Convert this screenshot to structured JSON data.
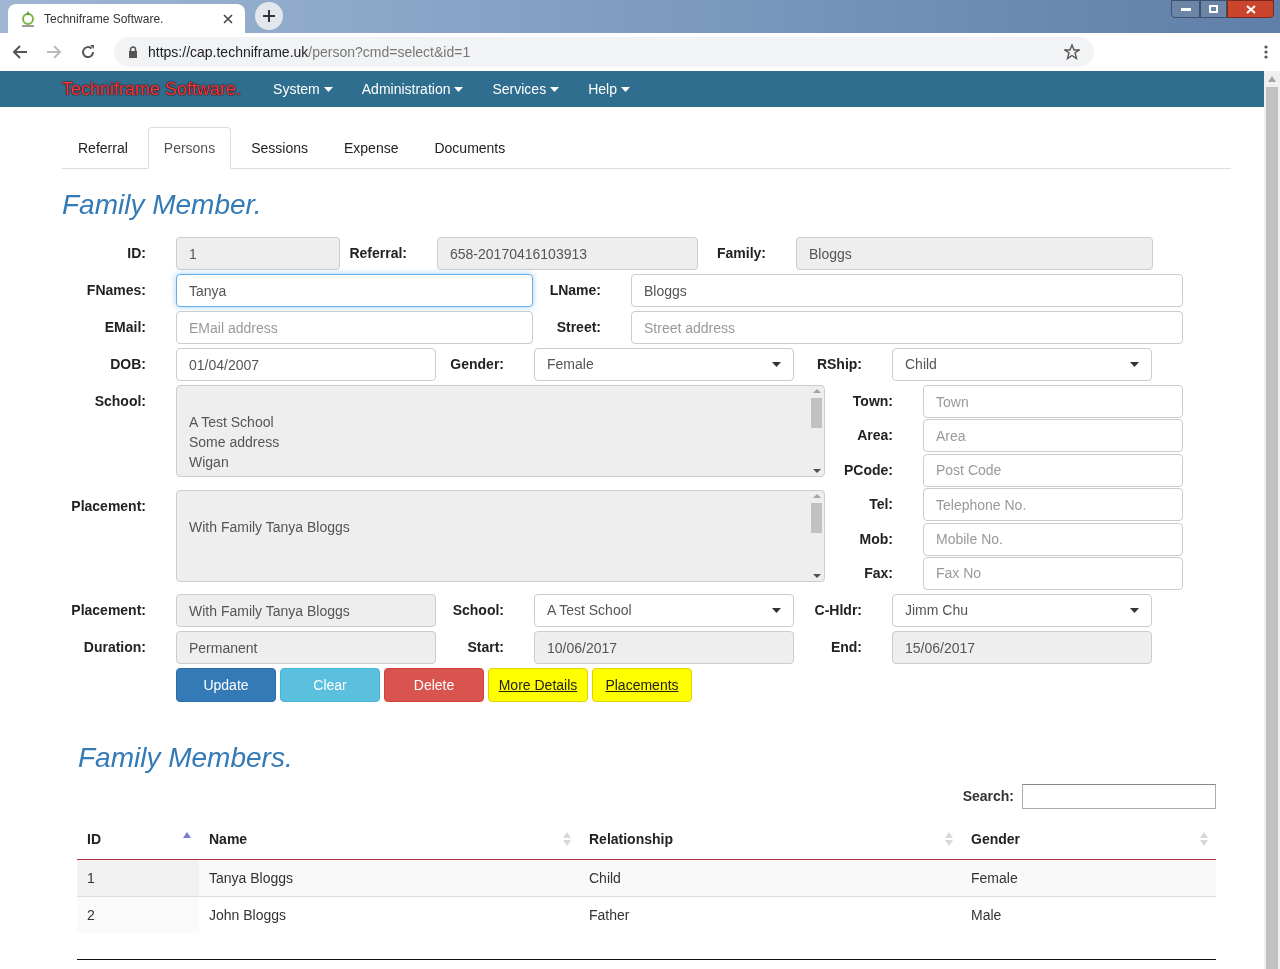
{
  "browser": {
    "tab_title": "Techniframe Software.",
    "url_host": "https://cap.techniframe.uk",
    "url_path": "/person?cmd=select&id=1"
  },
  "navbar": {
    "brand": "Techniframe Software.",
    "menus": [
      "System",
      "Administration",
      "Services",
      "Help"
    ]
  },
  "tabs": [
    {
      "label": "Referral",
      "selected": false
    },
    {
      "label": "Persons",
      "selected": true
    },
    {
      "label": "Sessions",
      "selected": false
    },
    {
      "label": "Expense",
      "selected": false
    },
    {
      "label": "Documents",
      "selected": false
    }
  ],
  "form": {
    "title": "Family Member.",
    "top_rows": [
      [
        {
          "label": "ID:",
          "kind": "text",
          "value": "1",
          "disabled": true,
          "focused": false
        },
        {
          "label": "Referral:",
          "kind": "text",
          "value": "658-20170416103913",
          "disabled": true,
          "focused": false
        },
        {
          "label": "Family:",
          "kind": "text",
          "value": "Bloggs",
          "disabled": true,
          "focused": false
        }
      ],
      [
        {
          "label": "FNames:",
          "kind": "text",
          "value": "Tanya",
          "disabled": false,
          "focused": true
        },
        {
          "label": "LName:",
          "kind": "text",
          "value": "Bloggs",
          "disabled": false,
          "focused": false
        }
      ],
      [
        {
          "label": "EMail:",
          "kind": "text",
          "placeholder": "EMail address",
          "disabled": false,
          "focused": false
        },
        {
          "label": "Street:",
          "kind": "text",
          "placeholder": "Street address",
          "disabled": false,
          "focused": false
        }
      ],
      [
        {
          "label": "DOB:",
          "kind": "text",
          "value": "01/04/2007",
          "disabled": false,
          "focused": false
        },
        {
          "label": "Gender:",
          "kind": "select",
          "value": "Female",
          "disabled": false,
          "focused": false
        },
        {
          "label": "RShip:",
          "kind": "select",
          "value": "Child",
          "disabled": false,
          "focused": false
        }
      ]
    ],
    "text_areas": [
      {
        "label": "School:",
        "value": "\nA Test School\nSome address\nWigan"
      },
      {
        "label": "Placement:",
        "value": "\nWith Family Tanya Bloggs"
      }
    ],
    "side_fields": [
      {
        "label": "Town:",
        "placeholder": "Town"
      },
      {
        "label": "Area:",
        "placeholder": "Area"
      },
      {
        "label": "PCode:",
        "placeholder": "Post Code"
      },
      {
        "label": "Tel:",
        "placeholder": "Telephone No."
      },
      {
        "label": "Mob:",
        "placeholder": "Mobile No."
      },
      {
        "label": "Fax:",
        "placeholder": "Fax No"
      }
    ],
    "bottom_rows": [
      [
        {
          "label": "Placement:",
          "kind": "text",
          "value": "With Family Tanya Bloggs",
          "disabled": true,
          "focused": false
        },
        {
          "label": "School:",
          "kind": "select",
          "value": "A Test School",
          "disabled": false,
          "focused": false
        },
        {
          "label": "C-Hldr:",
          "kind": "select",
          "value": "Jimm Chu",
          "disabled": false,
          "focused": false
        }
      ],
      [
        {
          "label": "Duration:",
          "kind": "text",
          "value": "Permanent",
          "disabled": true,
          "focused": false
        },
        {
          "label": "Start:",
          "kind": "text",
          "value": "10/06/2017",
          "disabled": true,
          "focused": false
        },
        {
          "label": "End:",
          "kind": "text",
          "value": "15/06/2017",
          "disabled": true,
          "focused": false
        }
      ]
    ],
    "buttons": [
      {
        "label": "Update",
        "kind": "primary"
      },
      {
        "label": "Clear",
        "kind": "info"
      },
      {
        "label": "Delete",
        "kind": "danger"
      },
      {
        "label": "More Details",
        "kind": "highlight"
      },
      {
        "label": "Placements",
        "kind": "highlight"
      }
    ]
  },
  "table": {
    "title": "Family Members.",
    "search_label": "Search:",
    "columns": [
      {
        "label": "ID",
        "sorted": true
      },
      {
        "label": "Name",
        "sorted": false
      },
      {
        "label": "Relationship",
        "sorted": false
      },
      {
        "label": "Gender",
        "sorted": false
      }
    ],
    "rows": [
      [
        "1",
        "Tanya Bloggs",
        "Child",
        "Female"
      ],
      [
        "2",
        "John Bloggs",
        "Father",
        "Male"
      ]
    ]
  }
}
